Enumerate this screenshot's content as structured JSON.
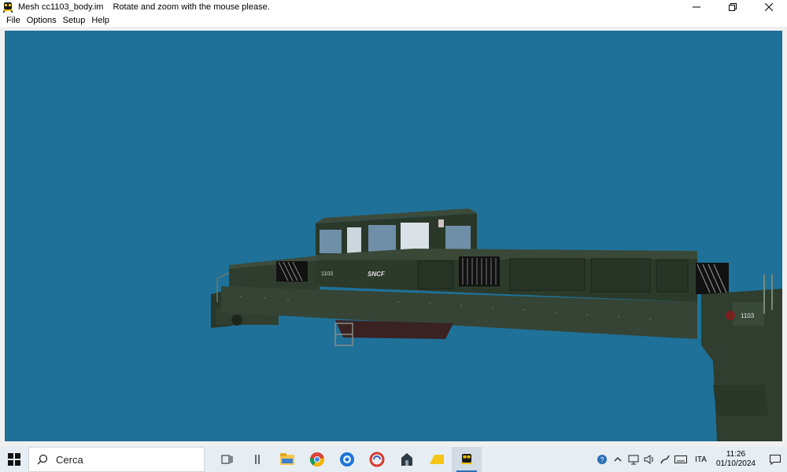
{
  "window": {
    "title": "Mesh cc1103_body.im",
    "hint": "Rotate and zoom with the mouse please."
  },
  "menu": {
    "items": [
      "File",
      "Options",
      "Setup",
      "Help"
    ]
  },
  "viewport": {
    "background": "#1f7199",
    "model": {
      "number_label": "1103",
      "brand_label": "SNCF",
      "rear_number_label": "1103",
      "body_color": "#2c3a2a"
    }
  },
  "taskbar": {
    "search_placeholder": "Cerca",
    "pinned_icons": [
      "task-view-icon",
      "widget-icon",
      "file-explorer-icon",
      "chrome-icon",
      "app-blue-icon",
      "app-ccleaner-icon",
      "app-dark-icon",
      "app-yellow-icon",
      "train-app-icon"
    ],
    "tray": {
      "lang": "ITA",
      "time": "11:26",
      "date": "01/10/2024"
    }
  }
}
